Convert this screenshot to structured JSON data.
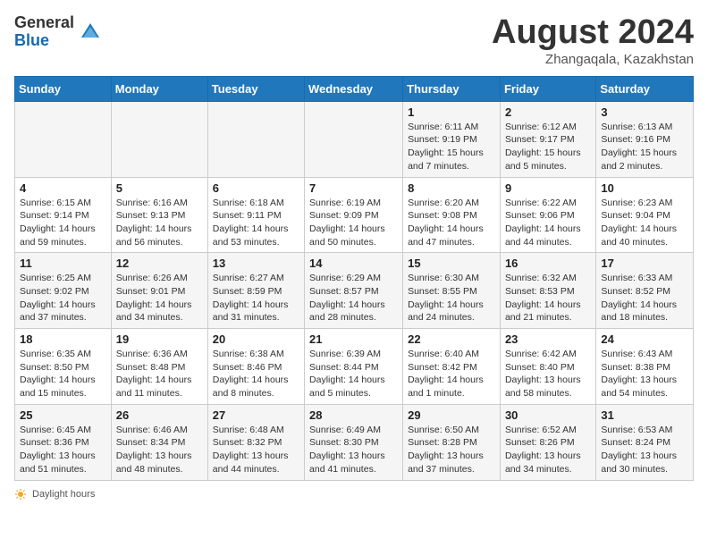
{
  "header": {
    "logo_general": "General",
    "logo_blue": "Blue",
    "month_title": "August 2024",
    "subtitle": "Zhangaqala, Kazakhstan"
  },
  "weekdays": [
    "Sunday",
    "Monday",
    "Tuesday",
    "Wednesday",
    "Thursday",
    "Friday",
    "Saturday"
  ],
  "weeks": [
    [
      {
        "day": "",
        "info": ""
      },
      {
        "day": "",
        "info": ""
      },
      {
        "day": "",
        "info": ""
      },
      {
        "day": "",
        "info": ""
      },
      {
        "day": "1",
        "info": "Sunrise: 6:11 AM\nSunset: 9:19 PM\nDaylight: 15 hours\nand 7 minutes."
      },
      {
        "day": "2",
        "info": "Sunrise: 6:12 AM\nSunset: 9:17 PM\nDaylight: 15 hours\nand 5 minutes."
      },
      {
        "day": "3",
        "info": "Sunrise: 6:13 AM\nSunset: 9:16 PM\nDaylight: 15 hours\nand 2 minutes."
      }
    ],
    [
      {
        "day": "4",
        "info": "Sunrise: 6:15 AM\nSunset: 9:14 PM\nDaylight: 14 hours\nand 59 minutes."
      },
      {
        "day": "5",
        "info": "Sunrise: 6:16 AM\nSunset: 9:13 PM\nDaylight: 14 hours\nand 56 minutes."
      },
      {
        "day": "6",
        "info": "Sunrise: 6:18 AM\nSunset: 9:11 PM\nDaylight: 14 hours\nand 53 minutes."
      },
      {
        "day": "7",
        "info": "Sunrise: 6:19 AM\nSunset: 9:09 PM\nDaylight: 14 hours\nand 50 minutes."
      },
      {
        "day": "8",
        "info": "Sunrise: 6:20 AM\nSunset: 9:08 PM\nDaylight: 14 hours\nand 47 minutes."
      },
      {
        "day": "9",
        "info": "Sunrise: 6:22 AM\nSunset: 9:06 PM\nDaylight: 14 hours\nand 44 minutes."
      },
      {
        "day": "10",
        "info": "Sunrise: 6:23 AM\nSunset: 9:04 PM\nDaylight: 14 hours\nand 40 minutes."
      }
    ],
    [
      {
        "day": "11",
        "info": "Sunrise: 6:25 AM\nSunset: 9:02 PM\nDaylight: 14 hours\nand 37 minutes."
      },
      {
        "day": "12",
        "info": "Sunrise: 6:26 AM\nSunset: 9:01 PM\nDaylight: 14 hours\nand 34 minutes."
      },
      {
        "day": "13",
        "info": "Sunrise: 6:27 AM\nSunset: 8:59 PM\nDaylight: 14 hours\nand 31 minutes."
      },
      {
        "day": "14",
        "info": "Sunrise: 6:29 AM\nSunset: 8:57 PM\nDaylight: 14 hours\nand 28 minutes."
      },
      {
        "day": "15",
        "info": "Sunrise: 6:30 AM\nSunset: 8:55 PM\nDaylight: 14 hours\nand 24 minutes."
      },
      {
        "day": "16",
        "info": "Sunrise: 6:32 AM\nSunset: 8:53 PM\nDaylight: 14 hours\nand 21 minutes."
      },
      {
        "day": "17",
        "info": "Sunrise: 6:33 AM\nSunset: 8:52 PM\nDaylight: 14 hours\nand 18 minutes."
      }
    ],
    [
      {
        "day": "18",
        "info": "Sunrise: 6:35 AM\nSunset: 8:50 PM\nDaylight: 14 hours\nand 15 minutes."
      },
      {
        "day": "19",
        "info": "Sunrise: 6:36 AM\nSunset: 8:48 PM\nDaylight: 14 hours\nand 11 minutes."
      },
      {
        "day": "20",
        "info": "Sunrise: 6:38 AM\nSunset: 8:46 PM\nDaylight: 14 hours\nand 8 minutes."
      },
      {
        "day": "21",
        "info": "Sunrise: 6:39 AM\nSunset: 8:44 PM\nDaylight: 14 hours\nand 5 minutes."
      },
      {
        "day": "22",
        "info": "Sunrise: 6:40 AM\nSunset: 8:42 PM\nDaylight: 14 hours\nand 1 minute."
      },
      {
        "day": "23",
        "info": "Sunrise: 6:42 AM\nSunset: 8:40 PM\nDaylight: 13 hours\nand 58 minutes."
      },
      {
        "day": "24",
        "info": "Sunrise: 6:43 AM\nSunset: 8:38 PM\nDaylight: 13 hours\nand 54 minutes."
      }
    ],
    [
      {
        "day": "25",
        "info": "Sunrise: 6:45 AM\nSunset: 8:36 PM\nDaylight: 13 hours\nand 51 minutes."
      },
      {
        "day": "26",
        "info": "Sunrise: 6:46 AM\nSunset: 8:34 PM\nDaylight: 13 hours\nand 48 minutes."
      },
      {
        "day": "27",
        "info": "Sunrise: 6:48 AM\nSunset: 8:32 PM\nDaylight: 13 hours\nand 44 minutes."
      },
      {
        "day": "28",
        "info": "Sunrise: 6:49 AM\nSunset: 8:30 PM\nDaylight: 13 hours\nand 41 minutes."
      },
      {
        "day": "29",
        "info": "Sunrise: 6:50 AM\nSunset: 8:28 PM\nDaylight: 13 hours\nand 37 minutes."
      },
      {
        "day": "30",
        "info": "Sunrise: 6:52 AM\nSunset: 8:26 PM\nDaylight: 13 hours\nand 34 minutes."
      },
      {
        "day": "31",
        "info": "Sunrise: 6:53 AM\nSunset: 8:24 PM\nDaylight: 13 hours\nand 30 minutes."
      }
    ]
  ],
  "footer": {
    "daylight_label": "Daylight hours"
  }
}
